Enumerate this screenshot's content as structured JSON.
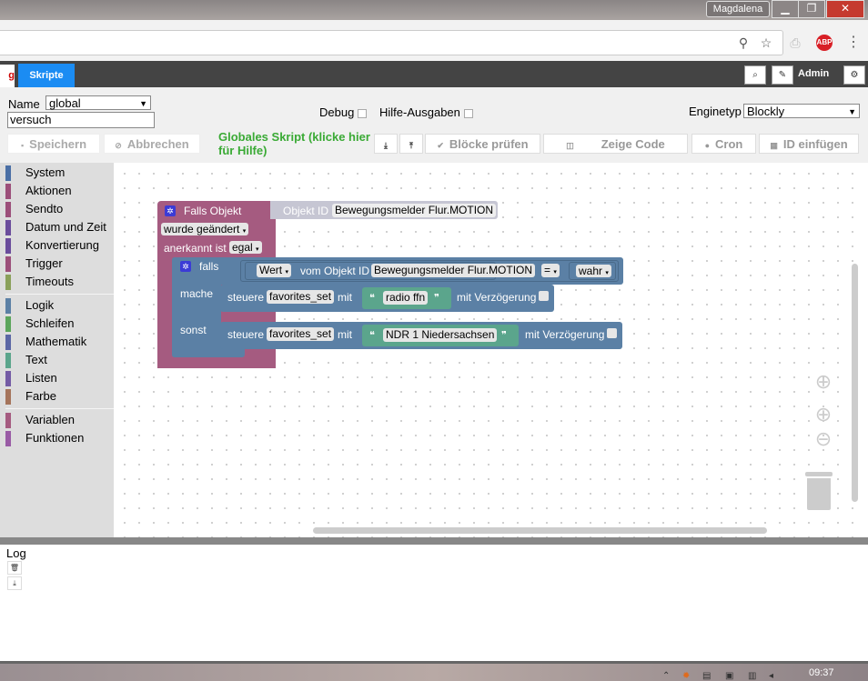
{
  "window": {
    "user": "Magdalena",
    "minimize": "▁",
    "restore": "❐",
    "close": "✕"
  },
  "browser": {
    "zoom_icon": "magnifier-icon",
    "star_icon": "star-icon",
    "pdf_icon": "pdf-icon",
    "abp_label": "ABP",
    "menu_icon": "kebab-icon"
  },
  "nav": {
    "prev_tab": "g",
    "tab_skripte": "Skripte",
    "admin": "Admin"
  },
  "panel": {
    "name_label": "Name",
    "name_value": "global",
    "script_name": "versuch",
    "debug_label": "Debug",
    "hilfe_label": "Hilfe-Ausgaben",
    "engine_label": "Enginetyp",
    "engine_value": "Blockly",
    "save": "Speichern",
    "cancel": "Abbrechen",
    "global_note": "Globales Skript (klicke hier für Hilfe)",
    "check_blocks": "Blöcke prüfen",
    "show_code": "Zeige Code",
    "cron": "Cron",
    "insert_id": "ID einfügen"
  },
  "toolbox": [
    {
      "label": "System",
      "color": "#4a6fa5"
    },
    {
      "label": "Aktionen",
      "color": "#9c4f7a"
    },
    {
      "label": "Sendto",
      "color": "#9c4f7a"
    },
    {
      "label": "Datum und Zeit",
      "color": "#6a4c9c"
    },
    {
      "label": "Konvertierung",
      "color": "#6a4c9c"
    },
    {
      "label": "Trigger",
      "color": "#9c4f7a"
    },
    {
      "label": "Timeouts",
      "color": "#8aa05a"
    },
    {
      "label": "Logik",
      "color": "#5b80a5"
    },
    {
      "label": "Schleifen",
      "color": "#5ba55b"
    },
    {
      "label": "Mathematik",
      "color": "#5b67a5"
    },
    {
      "label": "Text",
      "color": "#5ba58c"
    },
    {
      "label": "Listen",
      "color": "#745ba5"
    },
    {
      "label": "Farbe",
      "color": "#a5745b"
    },
    {
      "label": "Variablen",
      "color": "#a55b80"
    },
    {
      "label": "Funktionen",
      "color": "#995ba5"
    }
  ],
  "blocks": {
    "trigger_title": "Falls Objekt",
    "objekt_id_label": "Objekt ID",
    "objekt_id_value": "Bewegungsmelder Flur.MOTION",
    "changed": "wurde geändert",
    "ack_label": "anerkannt ist",
    "ack_value": "egal",
    "if_label": "falls",
    "wert": "Wert",
    "vom_objekt": "vom Objekt ID",
    "cond_object": "Bewegungsmelder Flur.MOTION",
    "op": "=",
    "bool_value": "wahr",
    "do_label": "mache",
    "else_label": "sonst",
    "control1": "steuere",
    "var1": "favorites_set",
    "mit1": "mit",
    "text1": "radio ffn",
    "delay1": "mit Verzögerung",
    "control2": "steuere",
    "var2": "favorites_set",
    "mit2": "mit",
    "text2": "NDR 1 Niedersachsen",
    "delay2": "mit Verzögerung",
    "open_quote": "❝",
    "close_quote": "❞"
  },
  "colors": {
    "trigger": "#a55b80",
    "logic": "#5b80a5",
    "text": "#5ba58c",
    "accent": "#1b8cf3",
    "global_note": "#3aaa35"
  },
  "log": {
    "label": "Log"
  },
  "taskbar": {
    "clock": "09:37"
  }
}
